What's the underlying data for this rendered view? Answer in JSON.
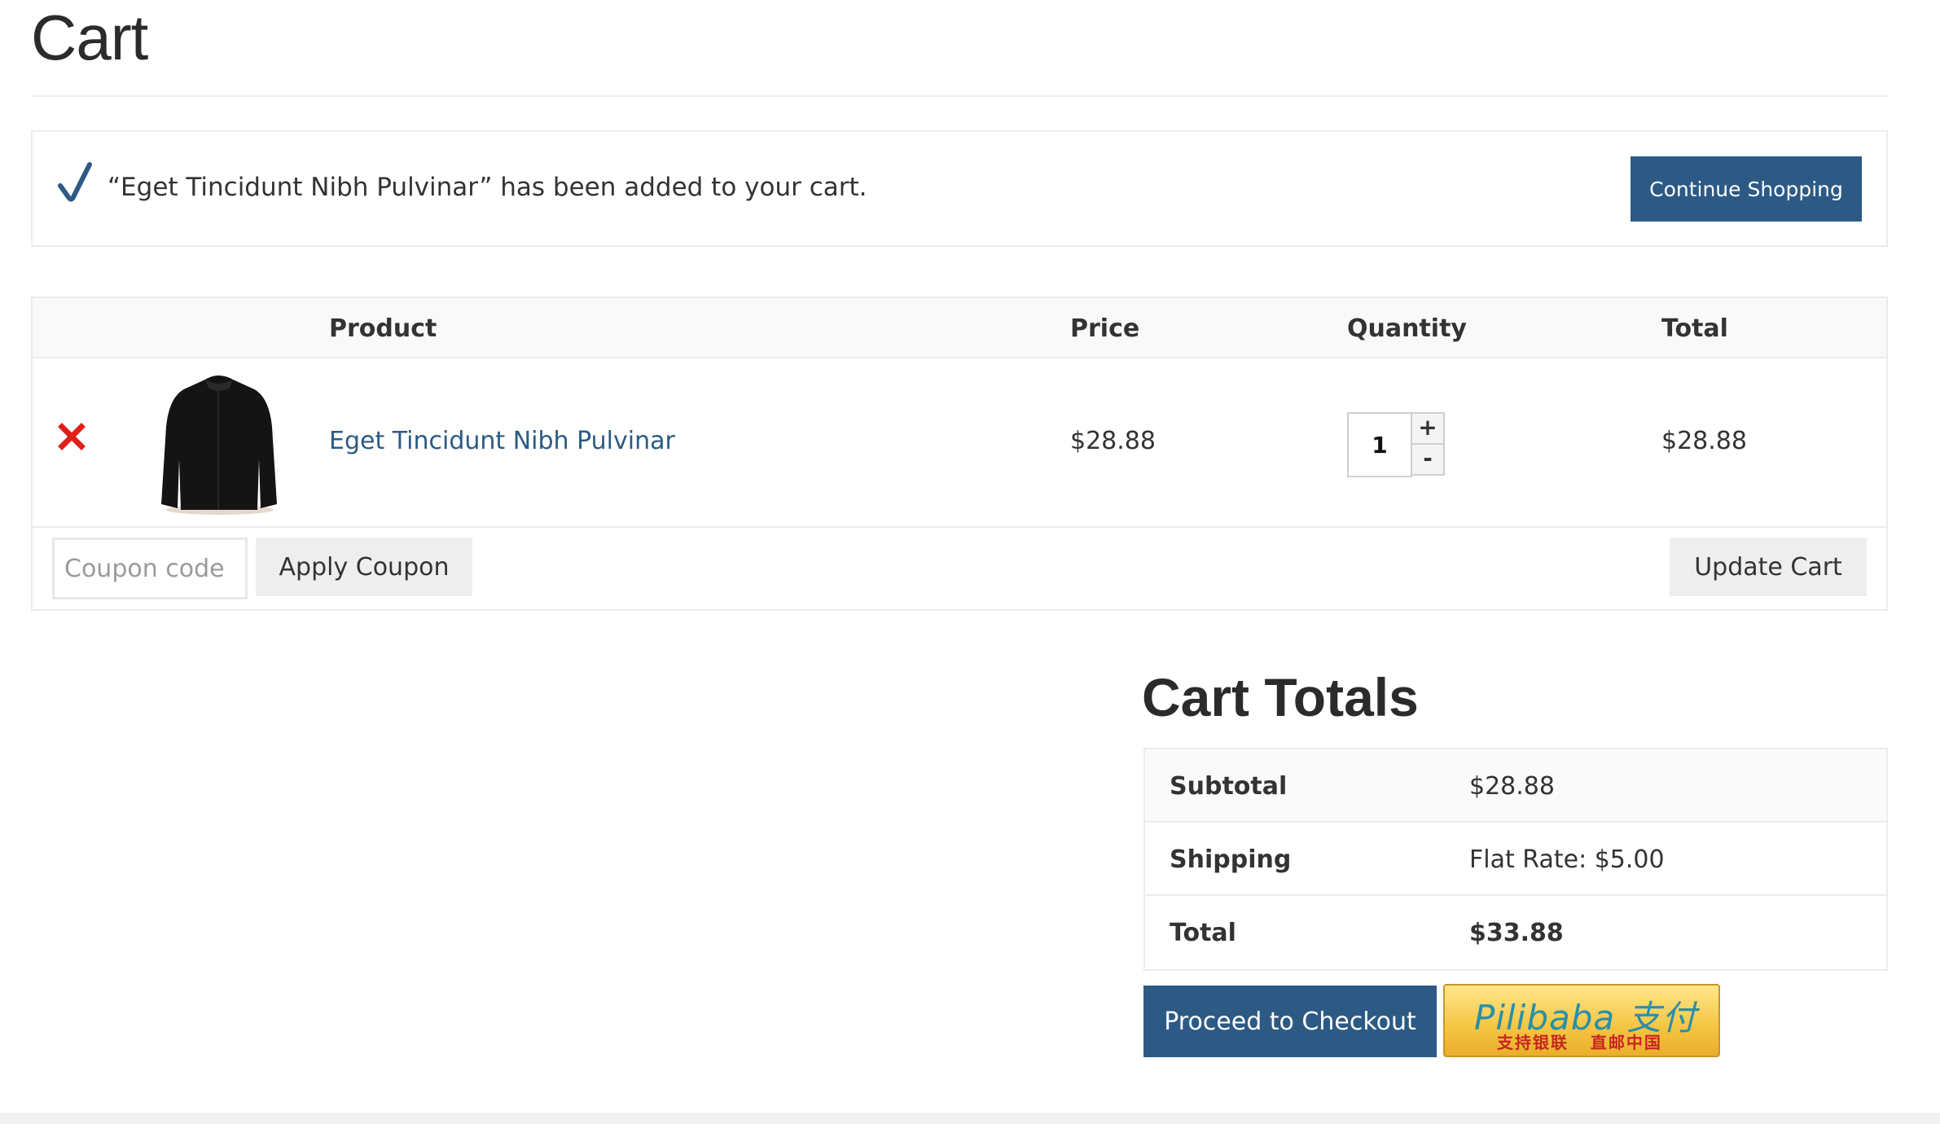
{
  "page": {
    "title": "Cart"
  },
  "notice": {
    "message": "“Eget Tincidunt Nibh Pulvinar” has been added to your cart.",
    "button_label": "Continue Shopping",
    "icon": "check-icon"
  },
  "cart": {
    "headers": {
      "product": "Product",
      "price": "Price",
      "quantity": "Quantity",
      "total": "Total"
    },
    "items": [
      {
        "name": "Eget Tincidunt Nibh Pulvinar",
        "price": "$28.88",
        "quantity": "1",
        "total": "$28.88",
        "thumbnail": "black-jacket-image"
      }
    ],
    "qty_plus": "+",
    "qty_minus": "-",
    "coupon_placeholder": "Coupon code",
    "apply_coupon_label": "Apply Coupon",
    "update_cart_label": "Update Cart"
  },
  "totals": {
    "title": "Cart Totals",
    "rows": [
      {
        "label": "Subtotal",
        "value": "$28.88"
      },
      {
        "label": "Shipping",
        "value": "Flat Rate: $5.00"
      },
      {
        "label": "Total",
        "value": "$33.88"
      }
    ],
    "checkout_label": "Proceed to Checkout",
    "pilibaba": {
      "main": "Pilibaba 支付",
      "sub": "支持银联   直邮中国"
    }
  },
  "colors": {
    "primary": "#2c5a85",
    "remove": "#e0201b",
    "pilibaba_gold": "#f5c542"
  }
}
